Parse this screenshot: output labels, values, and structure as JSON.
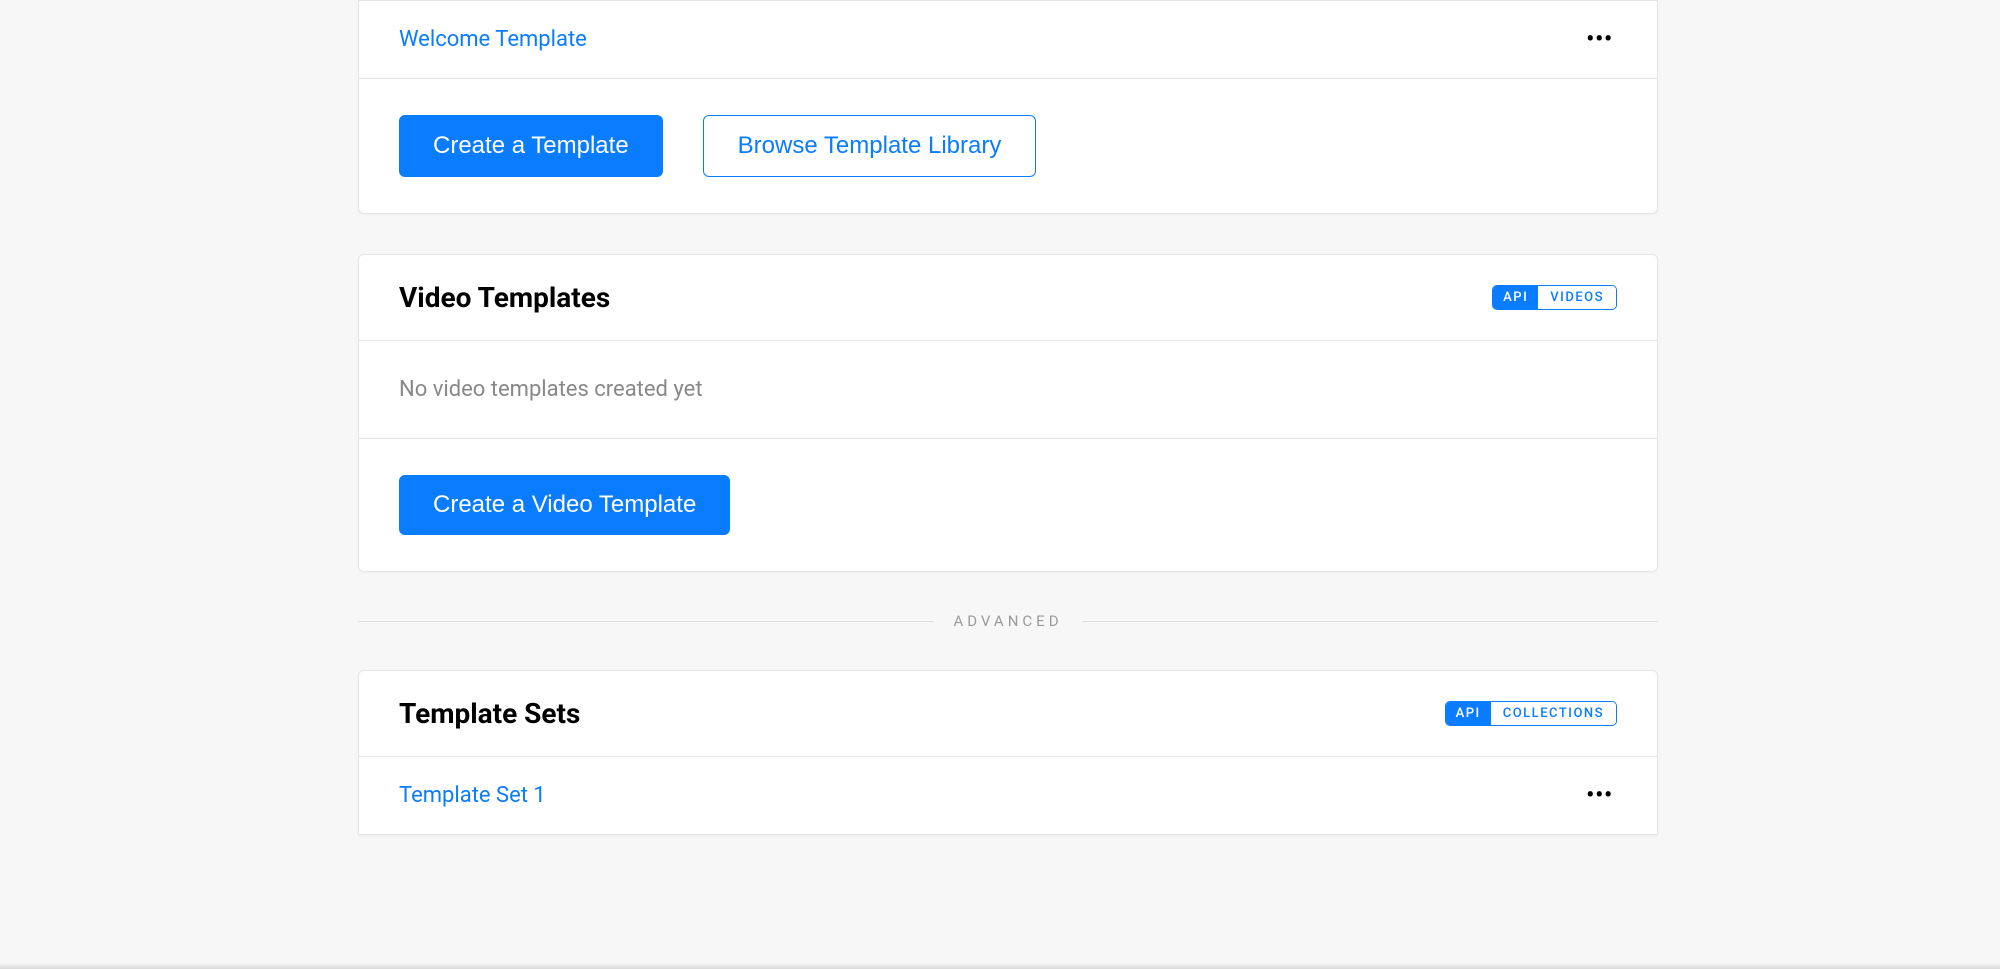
{
  "templates_card": {
    "items": [
      {
        "name": "Welcome Template"
      }
    ],
    "create_label": "Create a Template",
    "browse_label": "Browse Template Library"
  },
  "video_templates_card": {
    "title": "Video Templates",
    "badge_api": "API",
    "badge_right": "VIDEOS",
    "empty_message": "No video templates created yet",
    "create_label": "Create a Video Template"
  },
  "divider": {
    "label": "ADVANCED"
  },
  "template_sets_card": {
    "title": "Template Sets",
    "badge_api": "API",
    "badge_right": "COLLECTIONS",
    "items": [
      {
        "name": "Template Set 1"
      }
    ]
  }
}
